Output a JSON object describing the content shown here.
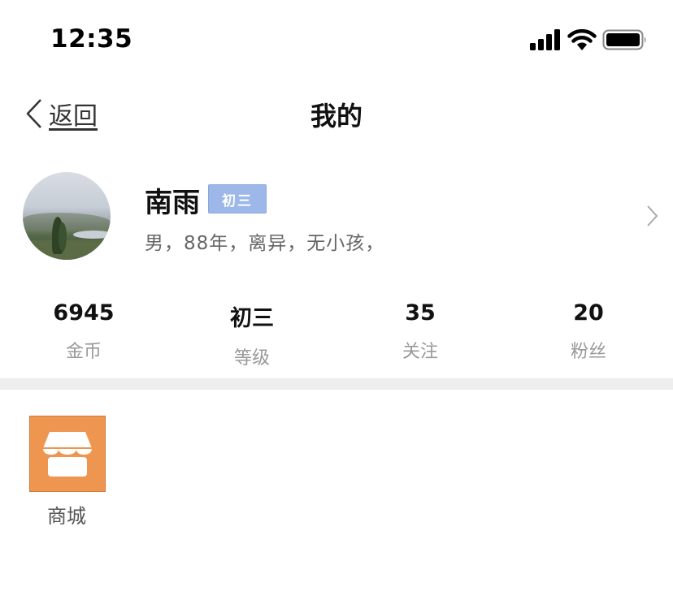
{
  "status_bar": {
    "time": "12:35"
  },
  "nav": {
    "back_label": "返回",
    "title": "我的"
  },
  "profile": {
    "name": "南雨",
    "level_badge": "初三",
    "info": "男，88年，离异，无小孩，"
  },
  "stats": [
    {
      "value": "6945",
      "label": "金币"
    },
    {
      "value": "初三",
      "label": "等级"
    },
    {
      "value": "35",
      "label": "关注"
    },
    {
      "value": "20",
      "label": "粉丝"
    }
  ],
  "features": [
    {
      "label": "商城",
      "icon": "shop-icon",
      "color": "#ee9550"
    }
  ],
  "colors": {
    "badge": "#9db7e8",
    "divider": "#eeeeee",
    "mall": "#ee9550"
  }
}
